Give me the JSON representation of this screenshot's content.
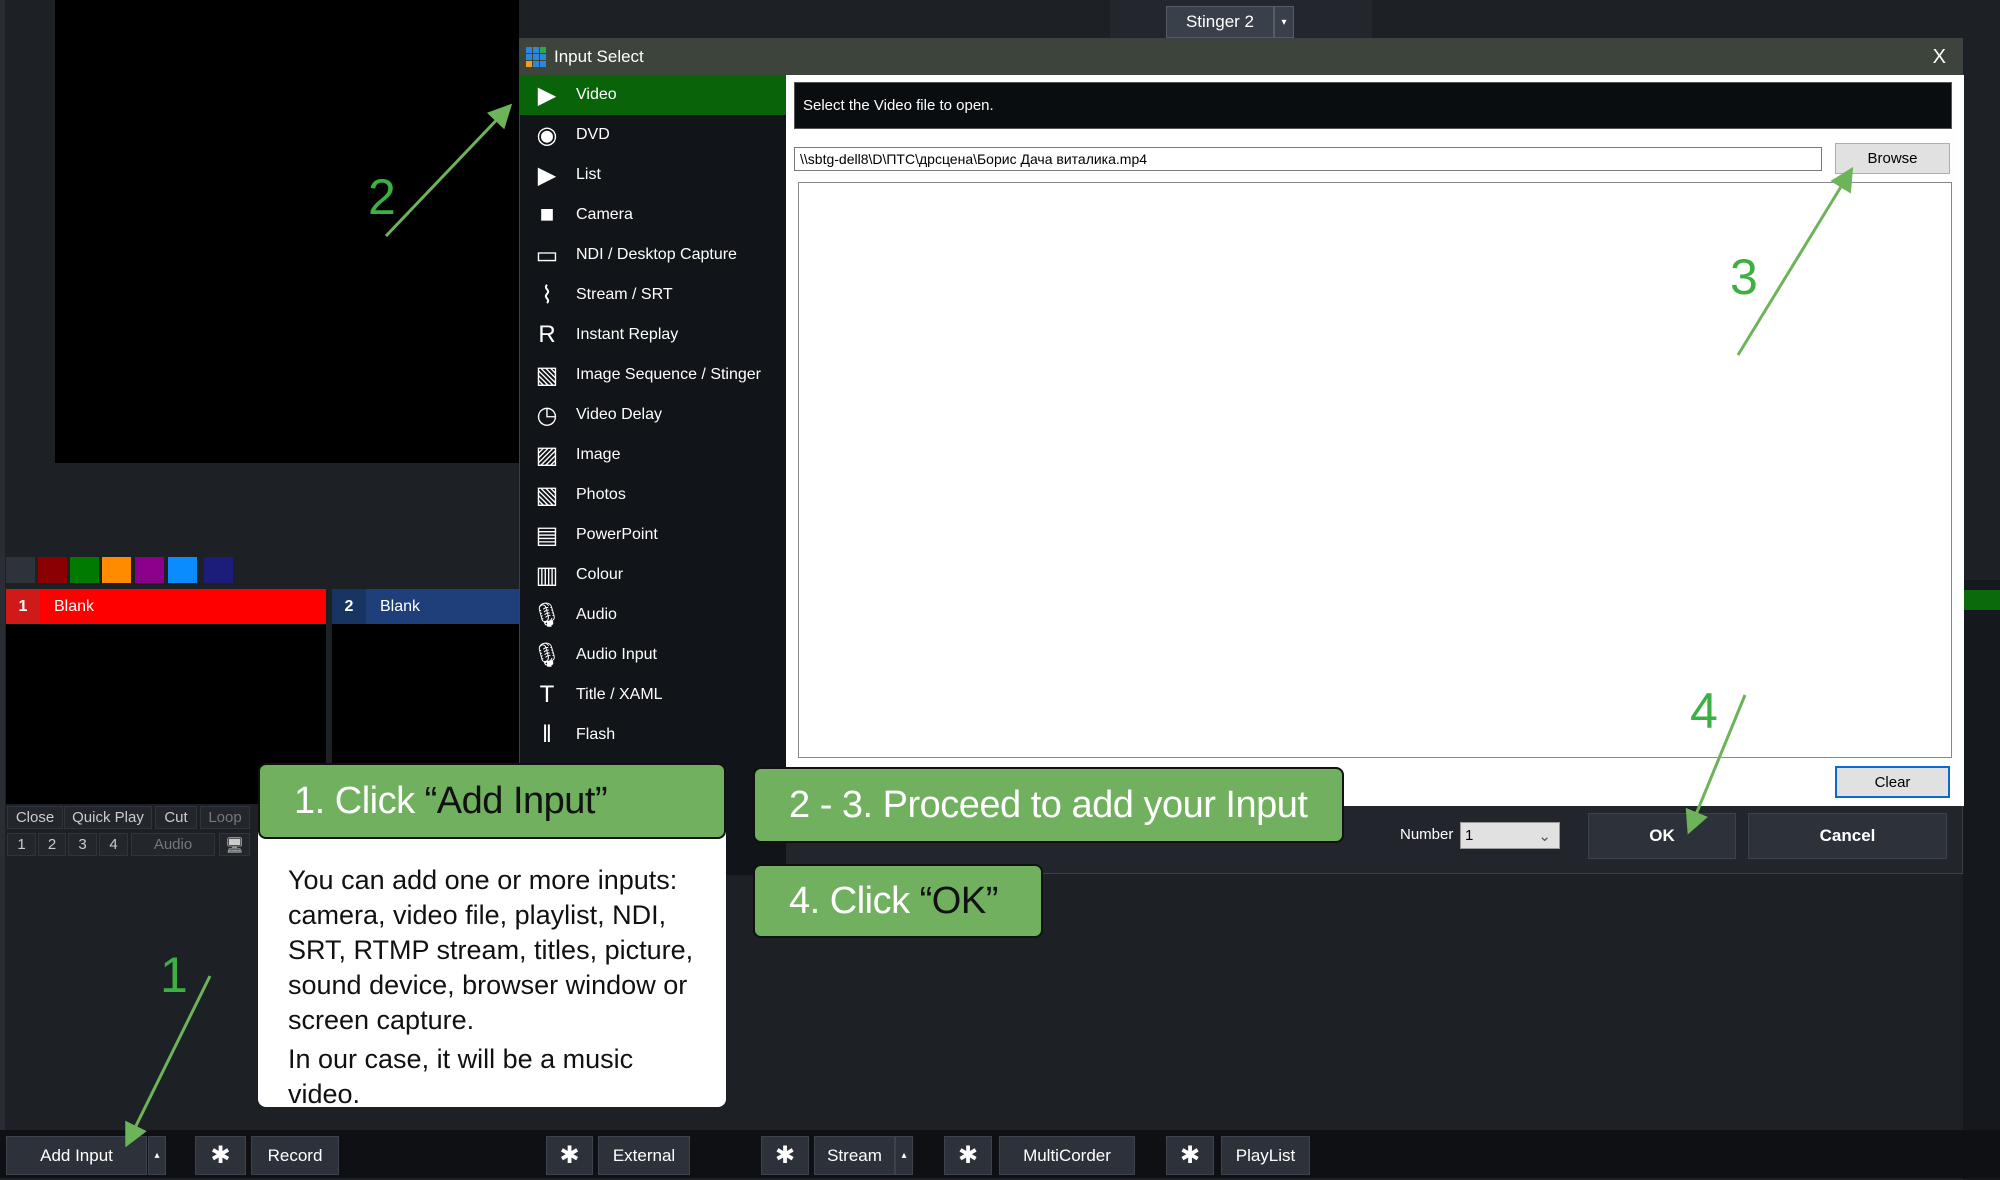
{
  "top_panel": {
    "stinger_label": "Stinger 2",
    "stinger_dropdown": "▾"
  },
  "swatches": [
    "#2e333a",
    "#8b0000",
    "#007a00",
    "#ff8c00",
    "#8b008b",
    "#0a8cff",
    "#1c1c7a"
  ],
  "inputs": [
    {
      "number": "1",
      "title": "Blank",
      "color": "#ff0000"
    },
    {
      "number": "2",
      "title": "Blank",
      "color": "#1e3f7a"
    }
  ],
  "input_controls": {
    "row1": [
      "Close",
      "Quick Play",
      "Cut",
      "Loop"
    ],
    "row2": [
      "1",
      "2",
      "3",
      "4",
      "Audio"
    ],
    "monitor_icon": "monitor-icon"
  },
  "dialog": {
    "title": "Input Select",
    "close": "X",
    "categories": [
      {
        "label": "Video",
        "icon": "▶",
        "selected": true
      },
      {
        "label": "DVD",
        "icon": "◉"
      },
      {
        "label": "List",
        "icon": "▶"
      },
      {
        "label": "Camera",
        "icon": "■"
      },
      {
        "label": "NDI / Desktop Capture",
        "icon": "▭"
      },
      {
        "label": "Stream / SRT",
        "icon": "⌇"
      },
      {
        "label": "Instant Replay",
        "icon": "R"
      },
      {
        "label": "Image Sequence / Stinger",
        "icon": "▧"
      },
      {
        "label": "Video Delay",
        "icon": "◷"
      },
      {
        "label": "Image",
        "icon": "▨"
      },
      {
        "label": "Photos",
        "icon": "▧"
      },
      {
        "label": "PowerPoint",
        "icon": "▤"
      },
      {
        "label": "Colour",
        "icon": "▥"
      },
      {
        "label": "Audio",
        "icon": "🎙"
      },
      {
        "label": "Audio Input",
        "icon": "🎙"
      },
      {
        "label": "Title / XAML",
        "icon": "T"
      },
      {
        "label": "Flash",
        "icon": "‖"
      }
    ],
    "instruction": "Select the Video file to open.",
    "file_path": "\\\\sbtg-dell8\\D\\ПТС\\дрсцена\\Борис Дача виталика.mp4",
    "browse": "Browse",
    "clear": "Clear",
    "number_label": "Number",
    "number_value": "1",
    "ok": "OK",
    "cancel": "Cancel"
  },
  "bottom_bar": {
    "add_input": "Add Input",
    "record": "Record",
    "external": "External",
    "stream": "Stream",
    "multicorder": "MultiCorder",
    "playlist": "PlayList",
    "up_arrow": "▴",
    "gear": "✱"
  },
  "annotations": {
    "callout1_prefix": "1. Click ",
    "callout1_target": "“Add Input”",
    "callout1_body": "You can add one or more inputs: camera, video file, playlist, NDI, SRT, RTMP stream, titles, picture, sound device, browser window or screen capture.",
    "callout1_body2": "In our case, it will be a music video.",
    "callout2": "2 - 3. Proceed to add your Input",
    "callout4_prefix": "4. Click ",
    "callout4_target": "“OK”",
    "steps": [
      "1",
      "2",
      "3",
      "4"
    ],
    "arrow_color": "#6db35a"
  }
}
